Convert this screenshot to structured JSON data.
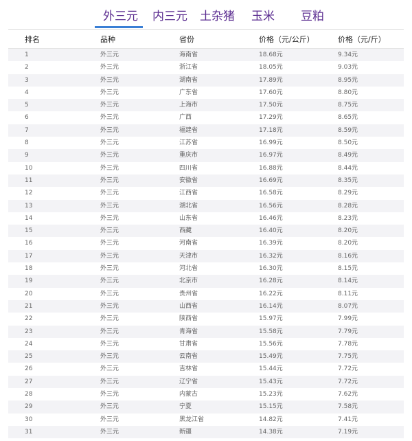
{
  "tabs": [
    {
      "label": "外三元",
      "active": true
    },
    {
      "label": "内三元",
      "active": false
    },
    {
      "label": "土杂猪",
      "active": false
    },
    {
      "label": "玉米",
      "active": false
    },
    {
      "label": "豆粕",
      "active": false
    }
  ],
  "table": {
    "headers": [
      "排名",
      "品种",
      "省份",
      "价格（元/公斤）",
      "价格（元/斤）"
    ],
    "rows": [
      [
        "1",
        "外三元",
        "海南省",
        "18.68元",
        "9.34元"
      ],
      [
        "2",
        "外三元",
        "浙江省",
        "18.05元",
        "9.03元"
      ],
      [
        "3",
        "外三元",
        "湖南省",
        "17.89元",
        "8.95元"
      ],
      [
        "4",
        "外三元",
        "广东省",
        "17.60元",
        "8.80元"
      ],
      [
        "5",
        "外三元",
        "上海市",
        "17.50元",
        "8.75元"
      ],
      [
        "6",
        "外三元",
        "广西",
        "17.29元",
        "8.65元"
      ],
      [
        "7",
        "外三元",
        "福建省",
        "17.18元",
        "8.59元"
      ],
      [
        "8",
        "外三元",
        "江苏省",
        "16.99元",
        "8.50元"
      ],
      [
        "9",
        "外三元",
        "重庆市",
        "16.97元",
        "8.49元"
      ],
      [
        "10",
        "外三元",
        "四川省",
        "16.88元",
        "8.44元"
      ],
      [
        "11",
        "外三元",
        "安徽省",
        "16.69元",
        "8.35元"
      ],
      [
        "12",
        "外三元",
        "江西省",
        "16.58元",
        "8.29元"
      ],
      [
        "13",
        "外三元",
        "湖北省",
        "16.56元",
        "8.28元"
      ],
      [
        "14",
        "外三元",
        "山东省",
        "16.46元",
        "8.23元"
      ],
      [
        "15",
        "外三元",
        "西藏",
        "16.40元",
        "8.20元"
      ],
      [
        "16",
        "外三元",
        "河南省",
        "16.39元",
        "8.20元"
      ],
      [
        "17",
        "外三元",
        "天津市",
        "16.32元",
        "8.16元"
      ],
      [
        "18",
        "外三元",
        "河北省",
        "16.30元",
        "8.15元"
      ],
      [
        "19",
        "外三元",
        "北京市",
        "16.28元",
        "8.14元"
      ],
      [
        "20",
        "外三元",
        "贵州省",
        "16.22元",
        "8.11元"
      ],
      [
        "21",
        "外三元",
        "山西省",
        "16.14元",
        "8.07元"
      ],
      [
        "22",
        "外三元",
        "陕西省",
        "15.97元",
        "7.99元"
      ],
      [
        "23",
        "外三元",
        "青海省",
        "15.58元",
        "7.79元"
      ],
      [
        "24",
        "外三元",
        "甘肃省",
        "15.56元",
        "7.78元"
      ],
      [
        "25",
        "外三元",
        "云南省",
        "15.49元",
        "7.75元"
      ],
      [
        "26",
        "外三元",
        "吉林省",
        "15.44元",
        "7.72元"
      ],
      [
        "27",
        "外三元",
        "辽宁省",
        "15.43元",
        "7.72元"
      ],
      [
        "28",
        "外三元",
        "内蒙古",
        "15.23元",
        "7.62元"
      ],
      [
        "29",
        "外三元",
        "宁夏",
        "15.15元",
        "7.58元"
      ],
      [
        "30",
        "外三元",
        "黑龙江省",
        "14.82元",
        "7.41元"
      ],
      [
        "31",
        "外三元",
        "新疆",
        "14.38元",
        "7.19元"
      ]
    ]
  },
  "colors": {
    "tab_text": "#5b2d90",
    "tab_underline": "#3a7fd5",
    "row_stripe": "#f3f3f6"
  }
}
